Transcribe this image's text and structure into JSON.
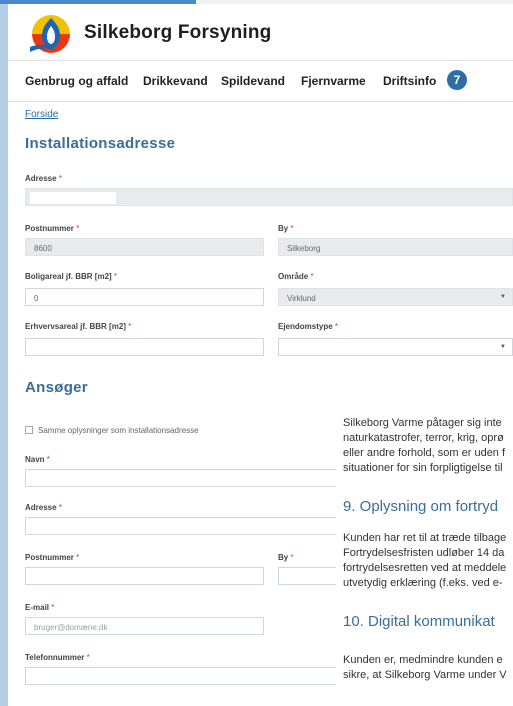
{
  "colors": {
    "accent": "#3a6e96",
    "badge": "#2c6fa8",
    "required": "#dd3333"
  },
  "brand": {
    "name": "Silkeborg Forsyning",
    "logo": "water-flame-logo-icon"
  },
  "nav": {
    "items": [
      "Genbrug og affald",
      "Drikkevand",
      "Spildevand",
      "Fjernvarme",
      "Driftsinfo"
    ],
    "badge_count": "7"
  },
  "breadcrumb": "Forside",
  "installation": {
    "title": "Installationsadresse",
    "adresse_label": "Adresse",
    "adresse_value": "",
    "postnummer_label": "Postnummer",
    "postnummer_value": "8600",
    "by_label": "By",
    "by_value": "Silkeborg",
    "boligareal_label": "Boligareal jf. BBR [m2]",
    "boligareal_value": "0",
    "omraade_label": "Område",
    "omraade_value": "Virklund",
    "erhverv_label": "Erhvervsareal jf. BBR [m2]",
    "erhverv_value": "",
    "ejendomstype_label": "Ejendomstype",
    "ejendomstype_value": ""
  },
  "applicant": {
    "title": "Ansøger",
    "same_info_label": "Samme oplysninger som installationsadresse",
    "navn_label": "Navn",
    "adresse_label": "Adresse",
    "postnummer_label": "Postnummer",
    "by_label": "By",
    "email_label": "E-mail",
    "email_placeholder": "bruger@domæne.dk",
    "telefon_label": "Telefonnummer"
  },
  "terms": {
    "p1": [
      "Silkeborg Varme påtager sig inte",
      "naturkatastrofer, terror, krig, oprø",
      "eller andre forhold, som er uden f",
      "situationer for sin forpligtigelse til"
    ],
    "h9": "9. Oplysning om fortryd",
    "p2": [
      "Kunden har ret til at træde tilbage",
      "Fortrydelsesfristen udløber 14 da",
      "fortrydelsesretten ved at meddele",
      "utvetydig erklæring (f.eks. ved e-"
    ],
    "h10": "10. Digital kommunikat",
    "p3": [
      "Kunden er, medmindre kunden e",
      "sikre, at Silkeborg Varme under V"
    ]
  }
}
